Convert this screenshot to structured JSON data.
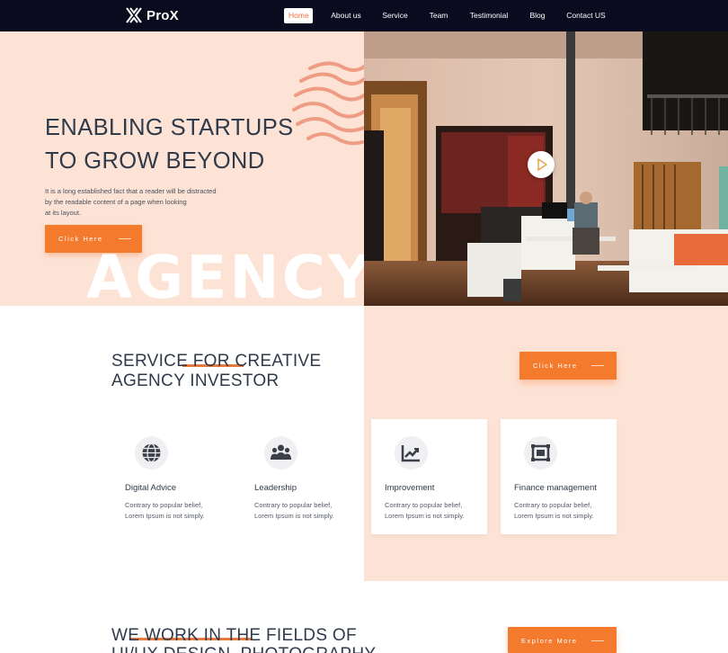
{
  "brand": {
    "name": "ProX"
  },
  "nav": {
    "items": [
      {
        "label": "Home",
        "active": true
      },
      {
        "label": "About us"
      },
      {
        "label": "Service"
      },
      {
        "label": "Team"
      },
      {
        "label": "Testimonial"
      },
      {
        "label": "Blog"
      },
      {
        "label": "Contact US"
      }
    ]
  },
  "hero": {
    "title_line1": "ENABLING STARTUPS",
    "title_line2": "TO GROW BEYOND",
    "text_line1": "It is a long established fact that a reader will be distracted",
    "text_line2": "by the readable content of a page when looking",
    "text_line3": "at its layout.",
    "button_label": "Click Here",
    "watermark": "AGENCY"
  },
  "service": {
    "title_line1": "SERVICE FOR CREATIVE",
    "title_line2": "AGENCY INVESTOR",
    "button_label": "Click Here",
    "cards": [
      {
        "icon": "globe-icon",
        "title": "Digital Advice",
        "desc1": "Contrary to popular belief,",
        "desc2": "Lorem Ipsum is not simply."
      },
      {
        "icon": "team-icon",
        "title": "Leadership",
        "desc1": "Contrary to popular belief,",
        "desc2": "Lorem Ipsum is not simply."
      },
      {
        "icon": "chart-icon",
        "title": "Improvement",
        "desc1": "Contrary to popular belief,",
        "desc2": "Lorem Ipsum is not simply."
      },
      {
        "icon": "grid-icon",
        "title": "Finance management",
        "desc1": "Contrary to popular belief,",
        "desc2": "Lorem Ipsum is not simply."
      }
    ]
  },
  "fields": {
    "title_line1": "WE WORK IN THE FIELDS OF",
    "title_line2": "UI/UX DESIGN, PHOTOGRAPHY",
    "button_label": "Explore More"
  },
  "colors": {
    "accent": "#f47a2e",
    "peach": "#fde3d6",
    "nav_bg": "#0b0b1f",
    "text_dark": "#2f3a4a"
  }
}
